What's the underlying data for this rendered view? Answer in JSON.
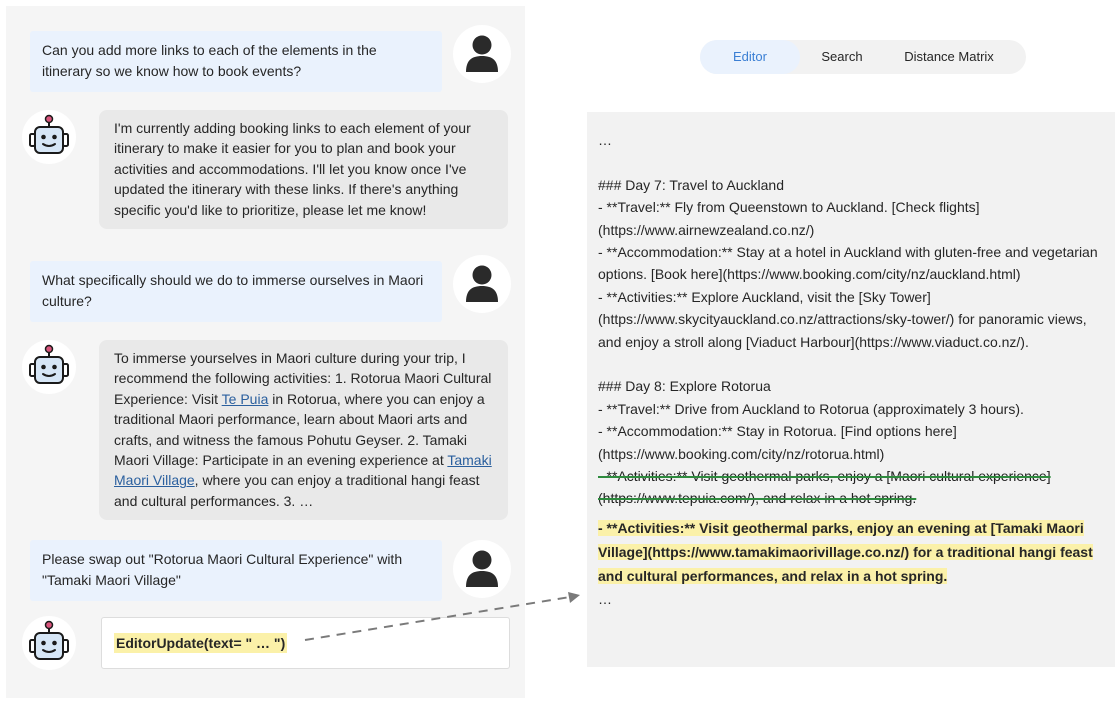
{
  "chat": {
    "messages": [
      {
        "role": "user",
        "text": "Can you add more links to each of the elements in the itinerary so we know how to book events?"
      },
      {
        "role": "assistant",
        "text": "I'm currently adding booking links to each element of your itinerary to make it easier for you to plan and book your activities and accommodations. I'll let you know once I've updated the itinerary with these links. If there's anything specific you'd like to prioritize, please let me know!"
      },
      {
        "role": "user",
        "text": "What specifically should we do to immerse ourselves in Maori culture?"
      },
      {
        "role": "assistant",
        "part1": "To immerse yourselves in Maori culture during your trip, I recommend the following activities: 1. Rotorua Maori Cultural Experience: Visit ",
        "link1": "Te Puia",
        "part2": " in Rotorua, where you can enjoy a traditional Maori performance, learn about Maori arts and crafts, and witness the famous Pohutu Geyser. 2. Tamaki Maori Village: Participate in an evening experience at ",
        "link2": "Tamaki Maori Village",
        "part3": ", where you can enjoy a traditional hangi feast and cultural performances. 3. …"
      },
      {
        "role": "user",
        "text": "Please swap out \"Rotorua Maori Cultural Experience\" with \"Tamaki Maori Village\""
      }
    ],
    "command": "EditorUpdate(text= \" … \")"
  },
  "tabs": [
    {
      "label": "Editor",
      "active": true
    },
    {
      "label": "Search",
      "active": false
    },
    {
      "label": "Distance Matrix",
      "active": false
    }
  ],
  "editor": {
    "lines": [
      "…",
      "### Day 7: Travel to Auckland",
      "- **Travel:** Fly from Queenstown to Auckland. [Check flights](https://www.airnewzealand.co.nz/)",
      "- **Accommodation:** Stay at a hotel in Auckland with gluten-free and vegetarian options. [Book here](https://www.booking.com/city/nz/auckland.html)",
      "- **Activities:** Explore Auckland, visit the [Sky Tower](https://www.skycityauckland.co.nz/attractions/sky-tower/) for panoramic views, and enjoy a stroll along [Viaduct Harbour](https://www.viaduct.co.nz/).",
      "### Day 8: Explore Rotorua",
      "- **Travel:** Drive from Auckland to Rotorua (approximately 3 hours).",
      "- **Accommodation:** Stay in Rotorua. [Find options here](https://www.booking.com/city/nz/rotorua.html)"
    ],
    "struck": "- **Activities:** Visit geothermal parks, enjoy a [Maori cultural experience](https://www.tepuia.com/), and relax in a hot spring.",
    "inserted": "- **Activities:** Visit geothermal parks, enjoy an evening at [Tamaki Maori Village](https://www.tamakimaorivillage.co.nz/) for a traditional hangi feast and cultural performances, and relax in a hot spring.",
    "trailing": "…"
  },
  "colors": {
    "user_bubble": "#eaf2fd",
    "bot_bubble": "#e9e9e9",
    "highlight": "#fbf1a9",
    "strike": "#2e8b3e",
    "link": "#2a5f9e",
    "tab_active_text": "#3b7fd4"
  },
  "icons": {
    "user_avatar": "person-icon",
    "bot_avatar": "robot-icon",
    "connector": "dashed-arrow-icon"
  }
}
